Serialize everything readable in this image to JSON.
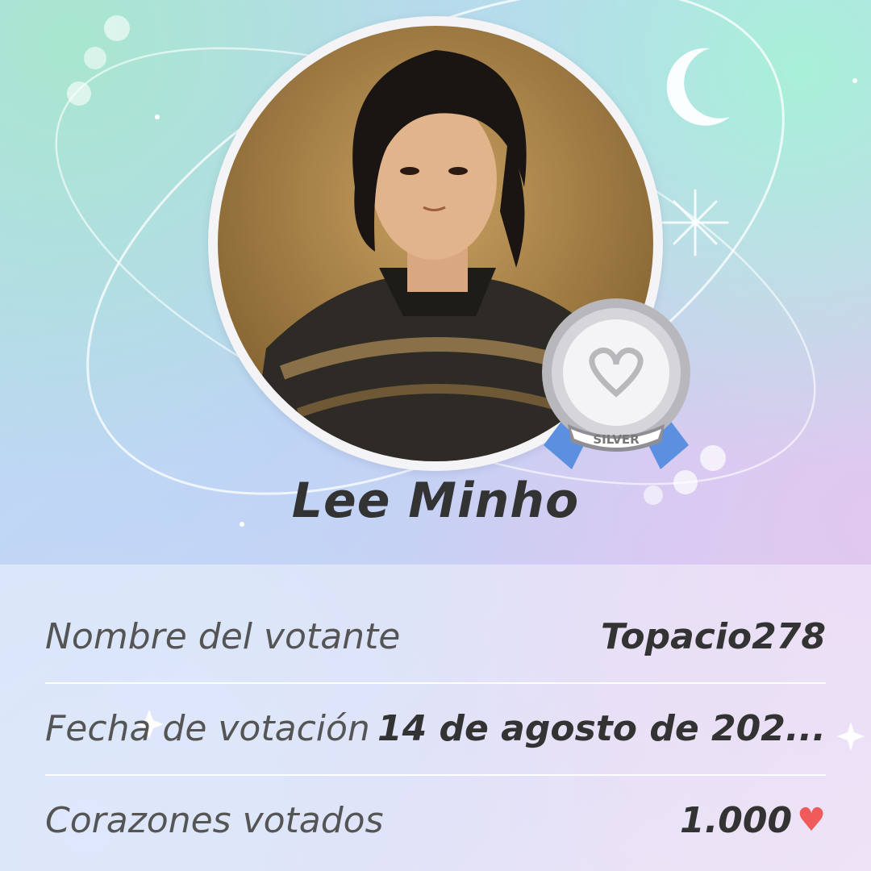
{
  "celebrity": {
    "name": "Lee Minho",
    "badge_label": "SILVER"
  },
  "vote_info": {
    "voter_label": "Nombre del votante",
    "voter_value": "Topacio278",
    "date_label": "Fecha de votación",
    "date_value": "14 de agosto de 202...",
    "hearts_label": "Corazones votados",
    "hearts_value": "1.000"
  },
  "icons": {
    "heart": "heart-icon",
    "moon": "moon-icon",
    "badge": "silver-medal-icon"
  },
  "colors": {
    "heart": "#f05a5a",
    "ribbon": "#5b8fe0",
    "medal": "#c8c8cc"
  }
}
